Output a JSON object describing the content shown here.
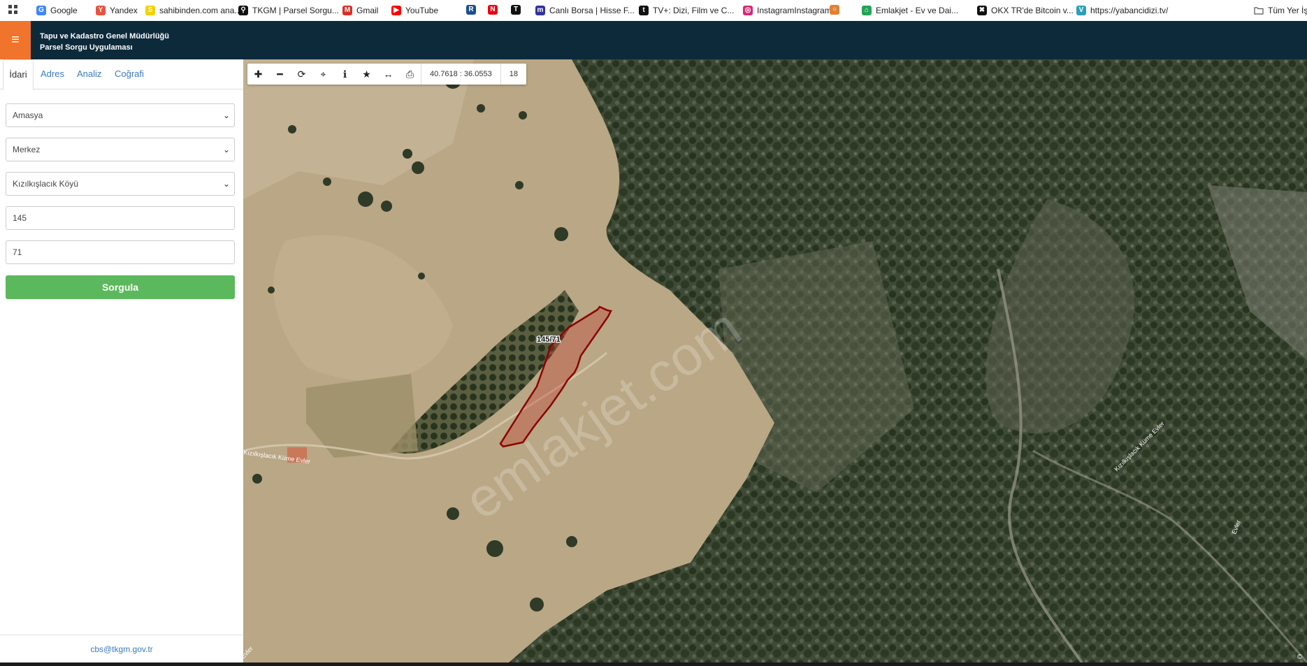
{
  "bookmarks": [
    {
      "label": "Google",
      "icon": "google-icon",
      "color": "#4285f4",
      "glyph": "G"
    },
    {
      "label": "Yandex",
      "icon": "yandex-icon",
      "color": "#e8533f",
      "glyph": "Y"
    },
    {
      "label": "sahibinden.com ana...",
      "icon": "sahibinden-icon",
      "color": "#f4d100",
      "glyph": "S"
    },
    {
      "label": "TKGM | Parsel Sorgu...",
      "icon": "map-pin-icon",
      "color": "#111111",
      "glyph": "⚲"
    },
    {
      "label": "Gmail",
      "icon": "gmail-icon",
      "color": "#d93025",
      "glyph": "M"
    },
    {
      "label": "YouTube",
      "icon": "youtube-icon",
      "color": "#ff0000",
      "glyph": "▶"
    },
    {
      "label": "",
      "icon": "news-icon",
      "color": "#1b4f8c",
      "glyph": "R"
    },
    {
      "label": "",
      "icon": "netflix-icon",
      "color": "#e50914",
      "glyph": "N"
    },
    {
      "label": "",
      "icon": "tcc-icon",
      "color": "#111111",
      "glyph": "T"
    },
    {
      "label": "Canlı Borsa | Hisse F...",
      "icon": "borsa-icon",
      "color": "#333399",
      "glyph": "m"
    },
    {
      "label": "TV+: Dizi, Film ve C...",
      "icon": "tvplus-icon",
      "color": "#111111",
      "glyph": "t"
    },
    {
      "label": "InstagramInstagram...",
      "icon": "instagram-icon",
      "color": "#d62976",
      "glyph": "◎"
    },
    {
      "label": "",
      "icon": "circle-icon",
      "color": "#e08030",
      "glyph": "○"
    },
    {
      "label": "Emlakjet - Ev ve Dai...",
      "icon": "emlakjet-icon",
      "color": "#23a455",
      "glyph": "⌂"
    },
    {
      "label": "OKX TR'de Bitcoin v...",
      "icon": "okx-icon",
      "color": "#111111",
      "glyph": "✖"
    },
    {
      "label": "https://yabancidizi.tv/",
      "icon": "yabancidizi-icon",
      "color": "#2b9fb8",
      "glyph": "V"
    }
  ],
  "other_bookmarks": "Tüm Yer İş",
  "header": {
    "title_line1": "Tapu ve Kadastro Genel Müdürlüğü",
    "title_line2": "Parsel Sorgu Uygulaması",
    "menu_icon": "≡",
    "accent": "#f0742b",
    "bg": "#0d2a3b"
  },
  "tabs": [
    "İdari",
    "Adres",
    "Analiz",
    "Coğrafi"
  ],
  "form": {
    "il": "Amasya",
    "ilce": "Merkez",
    "mahalle": "Kızılkışlacık Köyü",
    "ada": "145",
    "parsel": "71",
    "submit": "Sorgula"
  },
  "footer_email": "cbs@tkgm.gov.tr",
  "map": {
    "coords": "40.7618 : 36.0553",
    "zoom": "18",
    "parcel_label": "145/71",
    "watermark": "emlakjet.com",
    "road_label_1": "Kızılkışlacık Küme Evler",
    "road_label_2": "Kızılkışlacık Küme Evler",
    "road_label_3": "Evler",
    "road_label_4": "Evler",
    "copyright": "©"
  },
  "toolbar": [
    "zoom-in",
    "zoom-out",
    "refresh",
    "locate",
    "info",
    "favorite",
    "measure",
    "print"
  ]
}
